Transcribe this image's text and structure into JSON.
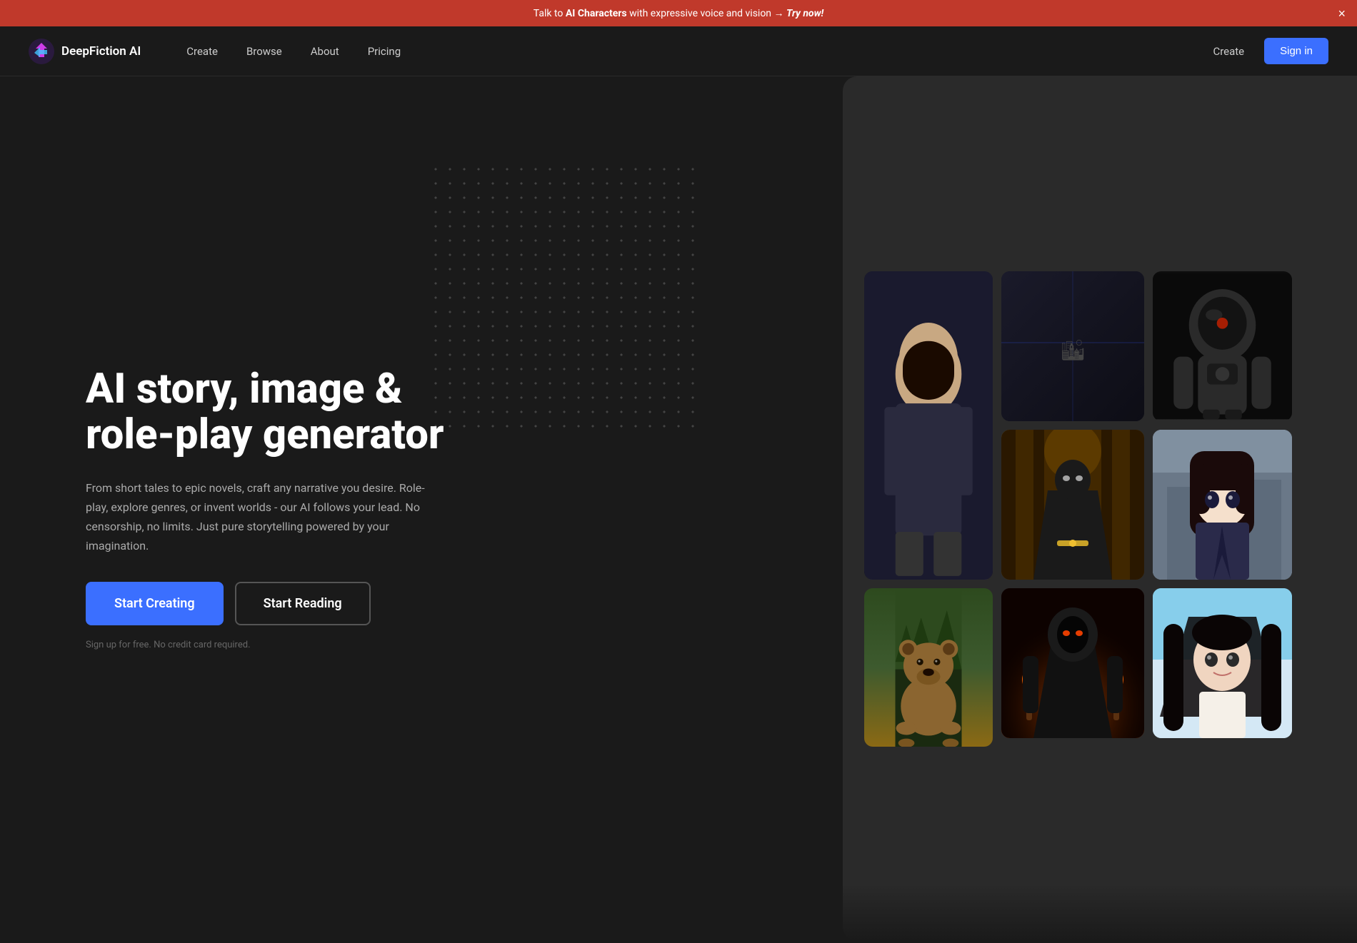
{
  "announcement": {
    "prefix_text": "Talk to ",
    "highlight_text": "AI Characters",
    "suffix_text": " with expressive voice and vision ",
    "arrow": "→",
    "cta_text": "Try now!",
    "close_label": "×"
  },
  "navbar": {
    "logo_text": "DeepFiction AI",
    "links": [
      {
        "label": "Create",
        "href": "#"
      },
      {
        "label": "Browse",
        "href": "#"
      },
      {
        "label": "About",
        "href": "#"
      },
      {
        "label": "Pricing",
        "href": "#"
      }
    ],
    "action_create_label": "Create",
    "sign_in_label": "Sign in"
  },
  "hero": {
    "title": "AI story, image & role-play generator",
    "description": "From short tales to epic novels, craft any narrative you desire. Role-play, explore genres, or invent worlds - our AI follows your lead. No censorship, no limits. Just pure storytelling powered by your imagination.",
    "btn_primary": "Start Creating",
    "btn_secondary": "Start Reading",
    "footnote": "Sign up for free. No credit card required."
  },
  "images": [
    {
      "id": "female-warrior",
      "alt": "Female warrior character"
    },
    {
      "id": "dark-top",
      "alt": "Dark background top"
    },
    {
      "id": "anime-girl",
      "alt": "Anime girl character"
    },
    {
      "id": "spaceman",
      "alt": "Space suit character"
    },
    {
      "id": "dark-knight",
      "alt": "Dark knight character"
    },
    {
      "id": "bear",
      "alt": "Brown bear"
    },
    {
      "id": "fire-mage",
      "alt": "Fire mage character"
    },
    {
      "id": "dark-woman",
      "alt": "Dark haired woman"
    }
  ]
}
